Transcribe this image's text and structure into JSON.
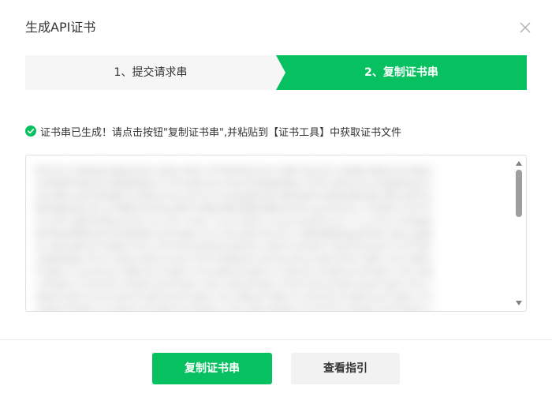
{
  "dialog": {
    "title": "生成API证书"
  },
  "steps": [
    {
      "label": "1、提交请求串"
    },
    {
      "label": "2、复制证书串"
    }
  ],
  "notice": {
    "text": "证书串已生成！请点击按钮\"复制证书串\",并粘贴到【证书工具】中获取证书文件"
  },
  "cert_box": {
    "content": "MIIE2zCCA8OgAwIBAgIUXq7vQ3bLk9Hc2J4T0mP8sRzA1yYwDQYJKoZIhvcNAQELBQAwXjELMAkGA1UEBhMCQ04xEzARBgNVBAoTClRlbnBheS5jb20xHTAbBgNVBAsTFFRlbnBheS5jb20gQ0EgQ2VudGVyMRswGQYDVQQDExJUZW5wYXkuY29tIFJvb3QgQ0EwHhcNMjMwMTAxMDAwMDAwWhcNMjgwMTAxMDAwMDAwWjCBijETMBEGA1UEAwwKMTYwMDAwMDAwMDEbMBkGA1UECgwS5b6u5L+h5ZWG5oi357O757ufMTYwNAYDVQQLDC3mtYvor5XllYbmiLfnu4/okKXvvIjmnInpmZDlhazlj7jvvIkxCzAJBgNVBAYMAkNOMREwDwYDVQQHDAhTaGVuWmhlbjCCASIwDQYJKoZIhvcNAQEBBQADggEPADCCAQoCggEBALx9Kq3mW7pY2vN8dL4cR1sT6hJ0fG5aE9bX3uM2kQ7iZ8oP1yV4nD6rC0wH5tA2gS9lF3jK7eB1xU8mN4qR6zT0vY2cW5pL9hD3sG1aE7kJ0fI4bM8nO2rQ5tU6vX9yZ1aB3cD5eF7gH9iJ1kL3mN5oP7qR9sT1uV3wX5yZ7aB9cD1eF3gH5iJ7kL9mN1oP3qR5sT7uV9wX1yZ3aB5cD7eF9gH1iJ3kL5mN7oP9qR1sT3uV5wX7yZ9aB1cD3eF5gH7iJ9kL1mN3oP5qR7sT9uV1wX3yZ5aB7cD9eF1gH3iJ5kL7mN9oP1qR3sT5uV7wX9yZ1aB3cD5eF7gH9iJ1kL3mN5oP7qR9sT1uV3wX5yZ7aB9cD1eF3gH5iJ7kL9mN1oP3qR5sT7uV9wX1yZ3aB5cD7eF9gH1iJ3kL5mN7oP9qR1sT3uV5wX7yZ9aB1cD3eF5gH7iJ9kL1mN3oP5qR7sT9uV1wX3yZ5aB7cD9eF1gH3iJ5kL7mN9oP1qR3sT5uV7wX9yZ1aB3cD5eF7gH9iJ1kL3mN5oP7qR9sT1uV3wX5yZ7aB9cD1eF3gH5iJ7kL9mN1oP3qR5sT7uV9wX1yZ3aB5cD7eF9gH1iJ3kL5mN7oP9qR1sT3uV5wX7yZ9aB1cD3eF5gH7iJ9kL1mN3oP5qR7sT9uV1wX3yZ5aB7cD9eF1gH3iJ5kL7mN9oP1qR3sT5uV7wX9y"
  },
  "buttons": {
    "copy_label": "复制证书串",
    "guide_label": "查看指引"
  },
  "colors": {
    "accent": "#07c160",
    "step_inactive": "#f6f6f6",
    "button_default": "#f2f2f2",
    "close_icon": "#b2b2b2"
  },
  "icons": {
    "close": "close-icon",
    "success": "check-circle-icon",
    "scroll_up": "triangle-up-icon",
    "scroll_down": "triangle-down-icon"
  }
}
